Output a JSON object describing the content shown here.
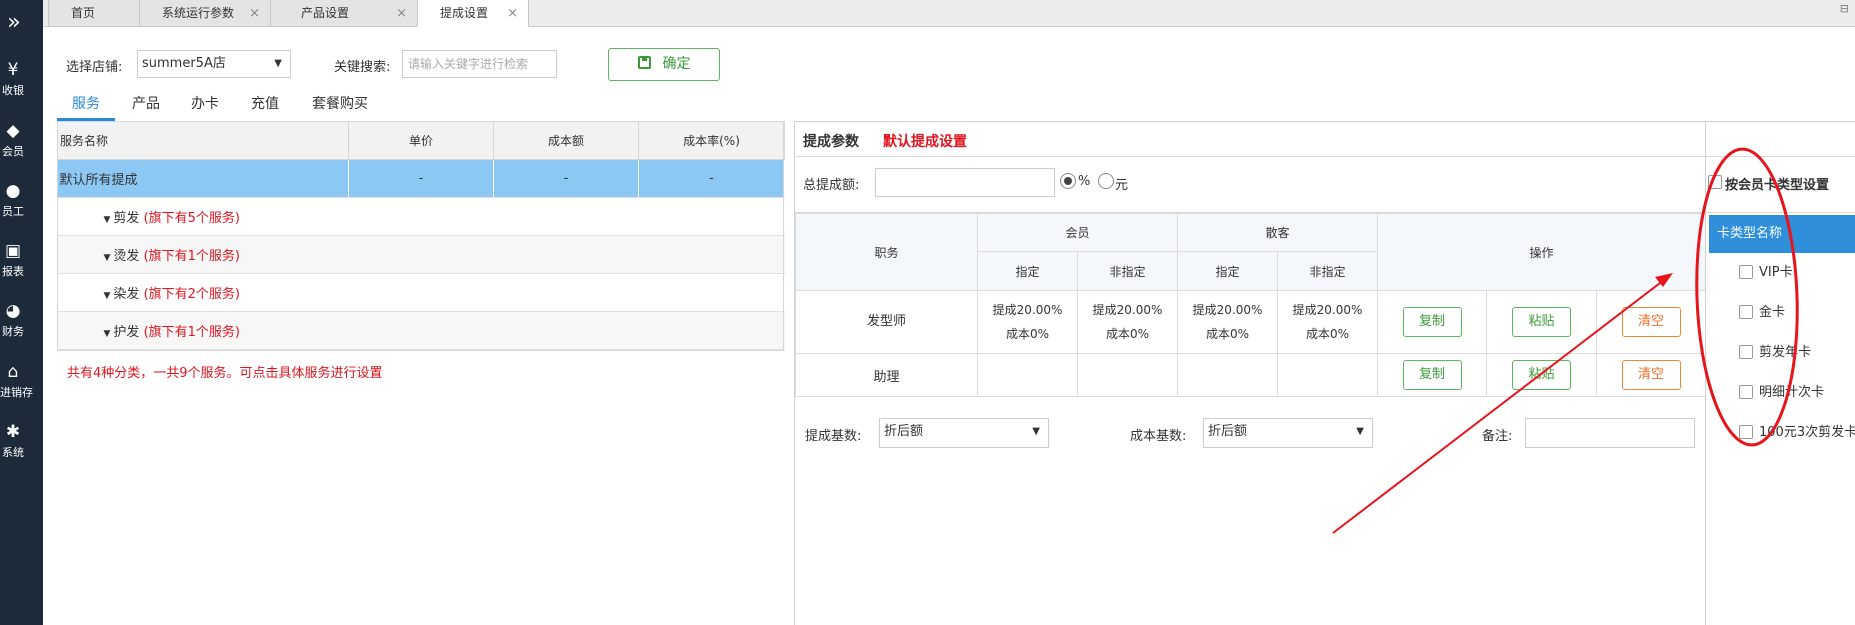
{
  "nav": {
    "expand_icon": "double-chevron-right-icon",
    "items": [
      {
        "label": "收银",
        "icon": "yen-icon",
        "glyph": "¥"
      },
      {
        "label": "会员",
        "icon": "diamond-icon",
        "glyph": "◆"
      },
      {
        "label": "员工",
        "icon": "user-icon",
        "glyph": "●"
      },
      {
        "label": "报表",
        "icon": "monitor-icon",
        "glyph": "▣"
      },
      {
        "label": "财务",
        "icon": "pie-chart-icon",
        "glyph": "◕"
      },
      {
        "label": "进销存",
        "icon": "home-icon",
        "glyph": "⌂"
      },
      {
        "label": "系统",
        "icon": "gear-icon",
        "glyph": "✱"
      }
    ]
  },
  "tabs": [
    {
      "label": "首页",
      "closable": false
    },
    {
      "label": "系统运行参数",
      "closable": true
    },
    {
      "label": "产品设置",
      "closable": true
    },
    {
      "label": "提成设置",
      "closable": true,
      "active": true
    }
  ],
  "filter": {
    "shop_label": "选择店铺:",
    "shop_value": "summer5A店",
    "search_label": "关键搜索:",
    "search_placeholder": "请输入关键字进行检索",
    "confirm_label": "确定"
  },
  "category_tabs": [
    "服务",
    "产品",
    "办卡",
    "充值",
    "套餐购买"
  ],
  "left_table": {
    "headers": [
      "服务名称",
      "单价",
      "成本额",
      "成本率(%)"
    ],
    "default_row": {
      "name": "默认所有提成",
      "price": "-",
      "cost": "-",
      "rate": "-"
    },
    "groups": [
      {
        "name": "剪发",
        "count": "(旗下有5个服务)"
      },
      {
        "name": "烫发",
        "count": "(旗下有1个服务)"
      },
      {
        "name": "染发",
        "count": "(旗下有2个服务)"
      },
      {
        "name": "护发",
        "count": "(旗下有1个服务)"
      }
    ],
    "summary": "共有4种分类，一共9个服务。可点击具体服务进行设置"
  },
  "params": {
    "title": "提成参数",
    "default_title": "默认提成设置",
    "total_label": "总提成额:",
    "unit_percent": "%",
    "unit_yuan": "元",
    "by_card_label": "按会员卡类型设置"
  },
  "commission_table": {
    "col_position": "职务",
    "col_member": "会员",
    "col_walkin": "散客",
    "col_ops": "操作",
    "sub_assigned": "指定",
    "sub_unassigned": "非指定",
    "rows": [
      {
        "position": "发型师",
        "cells": [
          {
            "line1": "提成20.00%",
            "line2": "成本0%"
          },
          {
            "line1": "提成20.00%",
            "line2": "成本0%"
          },
          {
            "line1": "提成20.00%",
            "line2": "成本0%"
          },
          {
            "line1": "提成20.00%",
            "line2": "成本0%"
          }
        ]
      },
      {
        "position": "助理",
        "cells": [
          {
            "line1": "",
            "line2": ""
          },
          {
            "line1": "",
            "line2": ""
          },
          {
            "line1": "",
            "line2": ""
          },
          {
            "line1": "",
            "line2": ""
          }
        ]
      }
    ],
    "copy_label": "复制",
    "paste_label": "粘贴",
    "clear_label": "清空"
  },
  "bottom_form": {
    "base_label": "提成基数:",
    "base_value": "折后额",
    "cost_base_label": "成本基数:",
    "cost_base_value": "折后额",
    "remark_label": "备注:"
  },
  "card_types": {
    "header": "卡类型名称",
    "items": [
      "VIP卡",
      "金卡",
      "剪发年卡",
      "明细计次卡",
      "100元3次剪发卡"
    ]
  },
  "colors": {
    "nav_bg": "#1d2a3a",
    "accent_blue": "#2a8ad8",
    "selected_row": "#8cc8f4",
    "red_text": "#e0141e",
    "green_button": "#5cb85c",
    "orange_button": "#f0883a",
    "annotation_red": "#e8141c"
  }
}
